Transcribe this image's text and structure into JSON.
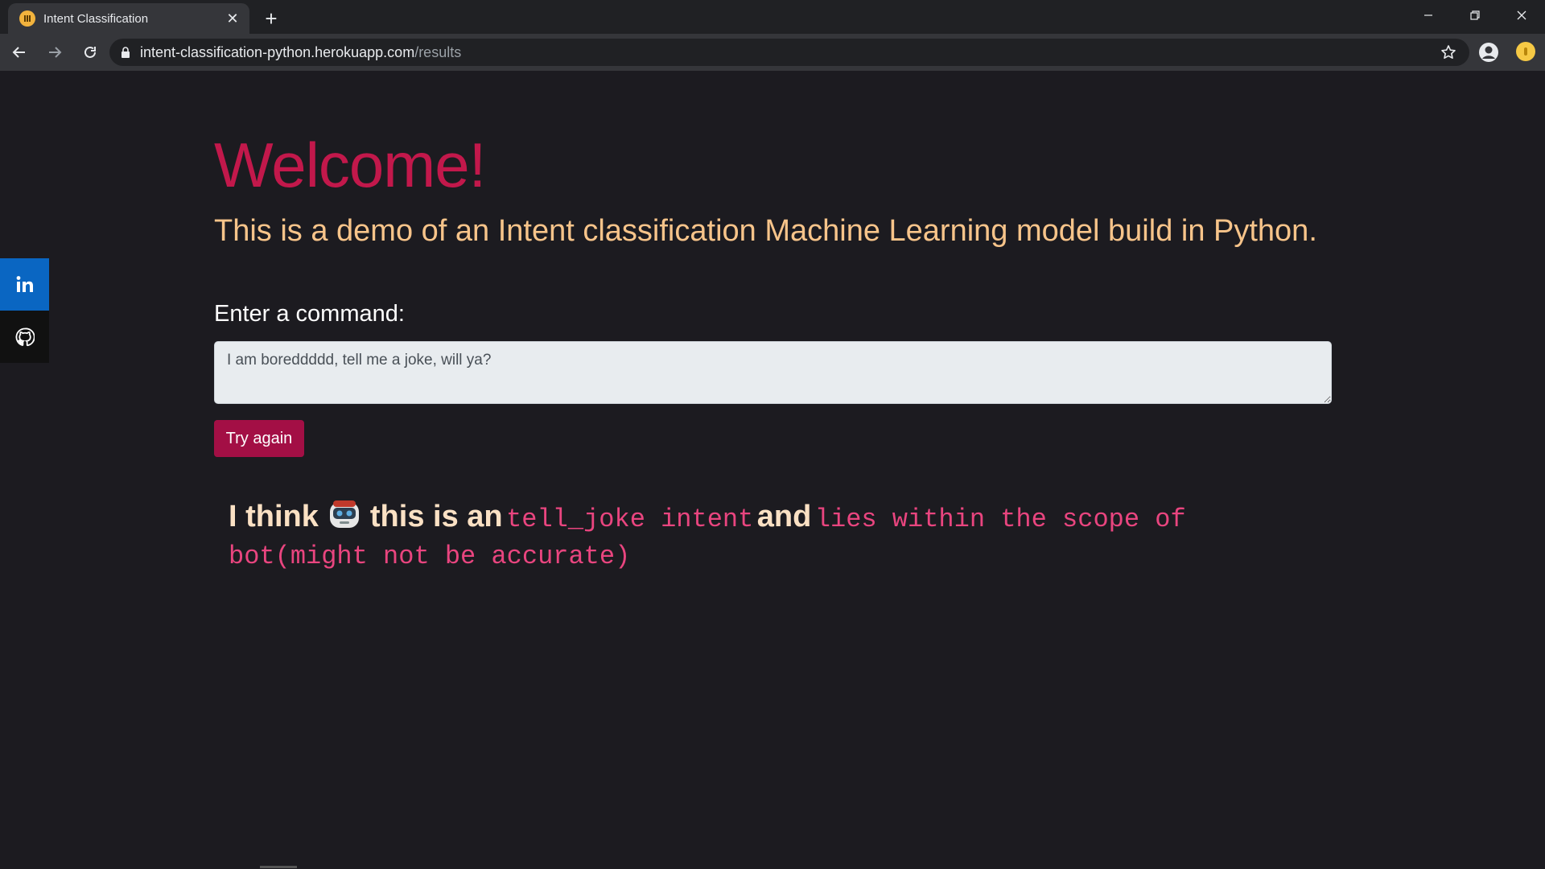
{
  "browser": {
    "tab": {
      "title": "Intent Classification",
      "close_label": "✕"
    },
    "new_tab_label": "+",
    "url": {
      "host": "intent-classification-python.herokuapp.com",
      "path": "/results"
    }
  },
  "page": {
    "welcome": "Welcome!",
    "subtitle": "This is a demo of an Intent classification Machine Learning model build in Python.",
    "command_label": "Enter a command:",
    "command_value": "I am boreddddd, tell me a joke, will ya?",
    "try_again_label": "Try again",
    "result": {
      "prefix": "I think",
      "middle": "this is an",
      "intent": "tell_joke intent",
      "connector": "and",
      "scope": "lies within the scope of bot(might not be accurate)"
    }
  },
  "icons": {
    "social": [
      "linkedin-icon",
      "github-icon"
    ],
    "robot": "robot-icon"
  },
  "colors": {
    "page_bg": "#1c1b20",
    "welcome": "#c2184b",
    "subtitle": "#f7c48a",
    "button": "#a30f45",
    "intent": "#e9457f",
    "linkedin": "#0a66c2"
  }
}
